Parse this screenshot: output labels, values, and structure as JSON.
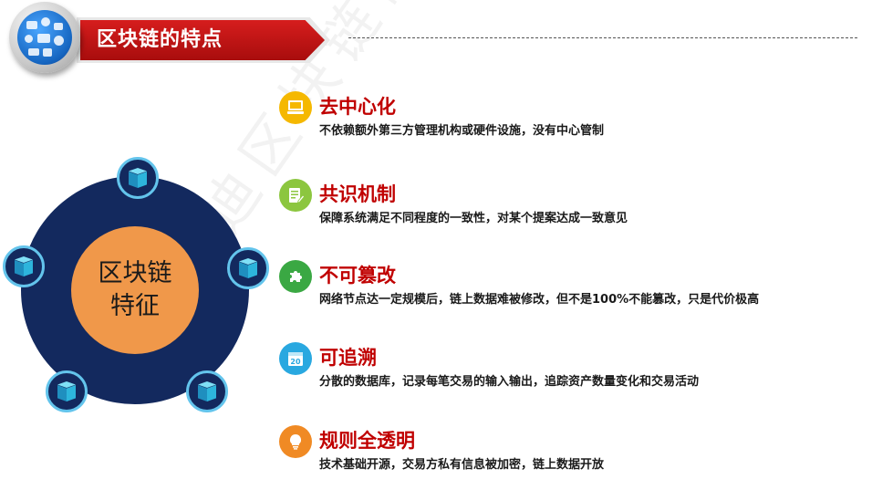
{
  "header": {
    "title": "区块链的特点"
  },
  "watermark": "赛迪区块链研究院",
  "diagram": {
    "center_line1": "区块链",
    "center_line2": "特征",
    "ring_color": "#13295e",
    "core_color": "#f0984a",
    "node_border_color": "#63c4ec",
    "node_icon": "blockchain-cube-icon"
  },
  "features": [
    {
      "title": "去中心化",
      "desc": "不依赖额外第三方管理机构或硬件设施，没有中心管制",
      "icon": "computer-icon",
      "color": "#f5b800"
    },
    {
      "title": "共识机制",
      "desc": "保障系统满足不同程度的一致性，对某个提案达成一致意见",
      "icon": "document-edit-icon",
      "color": "#8cc63f"
    },
    {
      "title": "不可篡改",
      "desc": "网络节点达一定规模后，链上数据难被修改，但不是100%不能篡改，只是代价极高",
      "icon": "puzzle-icon",
      "color": "#3aa843"
    },
    {
      "title": "可追溯",
      "desc": "分散的数据库，记录每笔交易的输入输出，追踪资产数量变化和交易活动",
      "icon": "calendar-icon",
      "color": "#29a8e0"
    },
    {
      "title": "规则全透明",
      "desc": "技术基础开源，交易方私有信息被加密，链上数据开放",
      "icon": "lightbulb-icon",
      "color": "#f08a24"
    }
  ]
}
